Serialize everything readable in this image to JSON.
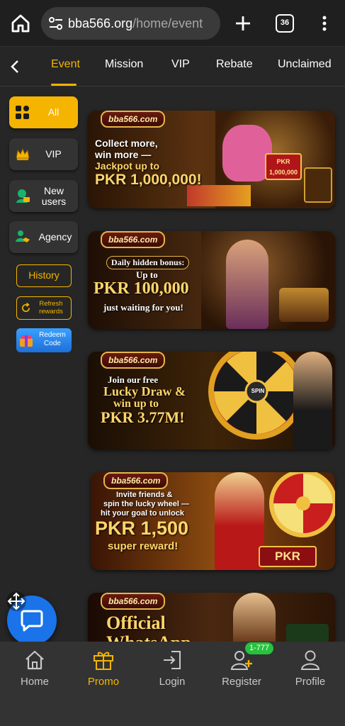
{
  "browser": {
    "url_host": "bba566.org",
    "url_path": "/home/event",
    "tab_count": "36"
  },
  "tabs": [
    {
      "label": "Event",
      "active": true
    },
    {
      "label": "Mission"
    },
    {
      "label": "VIP"
    },
    {
      "label": "Rebate"
    },
    {
      "label": "Unclaimed"
    }
  ],
  "sidebar": {
    "items": [
      {
        "label": "All",
        "active": true
      },
      {
        "label": "VIP"
      },
      {
        "label": "New\nusers"
      },
      {
        "label": "Agency"
      }
    ],
    "history_label": "History",
    "refresh_label": "Refresh\nrewards",
    "redeem_label": "Redeem\nCode"
  },
  "banners": [
    {
      "logo": "bba566.com",
      "lines": [
        "Collect more,",
        "win more —",
        "Jackpot up to",
        "PKR 1,000,000!"
      ],
      "tag_currency": "PKR",
      "tag_amount": "1,000,000"
    },
    {
      "logo": "bba566.com",
      "lines": [
        "Daily hidden bonus:",
        "Up to",
        "PKR 100,000",
        "just waiting for you!"
      ]
    },
    {
      "logo": "bba566.com",
      "lines": [
        "Join our free",
        "Lucky Draw &",
        "win up to",
        "PKR 3.77M!"
      ],
      "wheel_center": "SPIN"
    },
    {
      "logo": "bba566.com",
      "lines": [
        "Invite friends &",
        "spin the lucky wheel —",
        "hit your goal to unlock",
        "PKR 1,500",
        "super reward!"
      ],
      "tag_amount": "PKR 1,500"
    },
    {
      "logo": "bba566.com",
      "lines": [
        "Official",
        "WhatsApp"
      ]
    }
  ],
  "bottom_nav": [
    {
      "label": "Home",
      "icon": "home-icon"
    },
    {
      "label": "Promo",
      "icon": "gift-icon",
      "active": true
    },
    {
      "label": "Login",
      "icon": "login-icon"
    },
    {
      "label": "Register",
      "icon": "add-user-icon"
    },
    {
      "label": "Profile",
      "icon": "profile-icon"
    }
  ],
  "register_badge": "1-777",
  "colors": {
    "accent": "#f5b400",
    "background": "#262626",
    "nav_background": "#333333",
    "chat_fab": "#1a73e8",
    "badge": "#27c23c"
  }
}
